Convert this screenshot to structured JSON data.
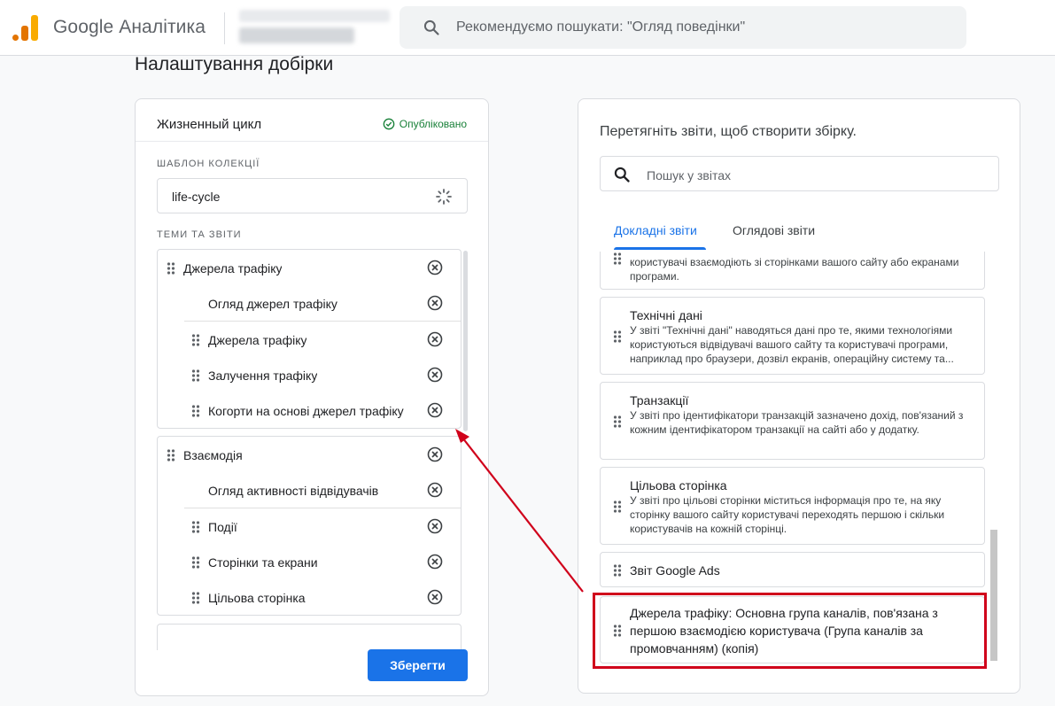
{
  "header": {
    "brand": "Google Аналітика",
    "search_placeholder": "Рекомендуємо пошукати: \"Огляд поведінки\""
  },
  "page": {
    "title": "Налаштування добірки"
  },
  "collection": {
    "name": "Жизненный цикл",
    "status": "Опубліковано",
    "template_label": "ШАБЛОН КОЛЕКЦІЇ",
    "template_value": "life-cycle",
    "topics_label": "ТЕМИ ТА ЗВІТИ",
    "topics": [
      {
        "title": "Джерела трафіку",
        "reports": [
          "Огляд джерел трафіку",
          "Джерела трафіку",
          "Залучення трафіку",
          "Когорти на основі джерел трафіку"
        ]
      },
      {
        "title": "Взаємодія",
        "reports": [
          "Огляд активності відвідувачів",
          "Події",
          "Сторінки та екрани",
          "Цільова сторінка"
        ]
      }
    ],
    "save_label": "Зберегти"
  },
  "library": {
    "heading": "Перетягніть звіти, щоб створити збірку.",
    "search_placeholder": "Пошук у звітах",
    "tabs": [
      "Докладні звіти",
      "Оглядові звіти"
    ],
    "cards": [
      {
        "title": "",
        "desc": "користувачі взаємодіють зі сторінками вашого сайту або екранами програми."
      },
      {
        "title": "Технічні дані",
        "desc": "У звіті \"Технічні дані\" наводяться дані про те, якими технологіями користуються відвідувачі вашого сайту та користувачі програми, наприклад про браузери, дозвіл екранів, операційну систему та..."
      },
      {
        "title": "Транзакції",
        "desc": "У звіті про ідентифікатори транзакцій зазначено дохід, пов'язаний з кожним ідентифікатором транзакції на сайті або у додатку."
      },
      {
        "title": "Цільова сторінка",
        "desc": "У звіті про цільові сторінки міститься інформація про те, на яку сторінку вашого сайту користувачі переходять першою і скільки користувачів на кожній сторінці."
      },
      {
        "title": "Звіт Google Ads",
        "desc": ""
      },
      {
        "title": "Джерела трафіку: Основна група каналів, пов'язана з першою взаємодією користувача (Група каналів за промовчанням) (копія)",
        "desc": ""
      }
    ]
  },
  "colors": {
    "accent": "#1a73e8",
    "highlight": "#d0021b",
    "published": "#188038"
  },
  "icons": [
    "analytics-logo-icon",
    "search-icon",
    "published-check-icon",
    "spinner-icon",
    "drag-handle-icon",
    "remove-icon"
  ]
}
